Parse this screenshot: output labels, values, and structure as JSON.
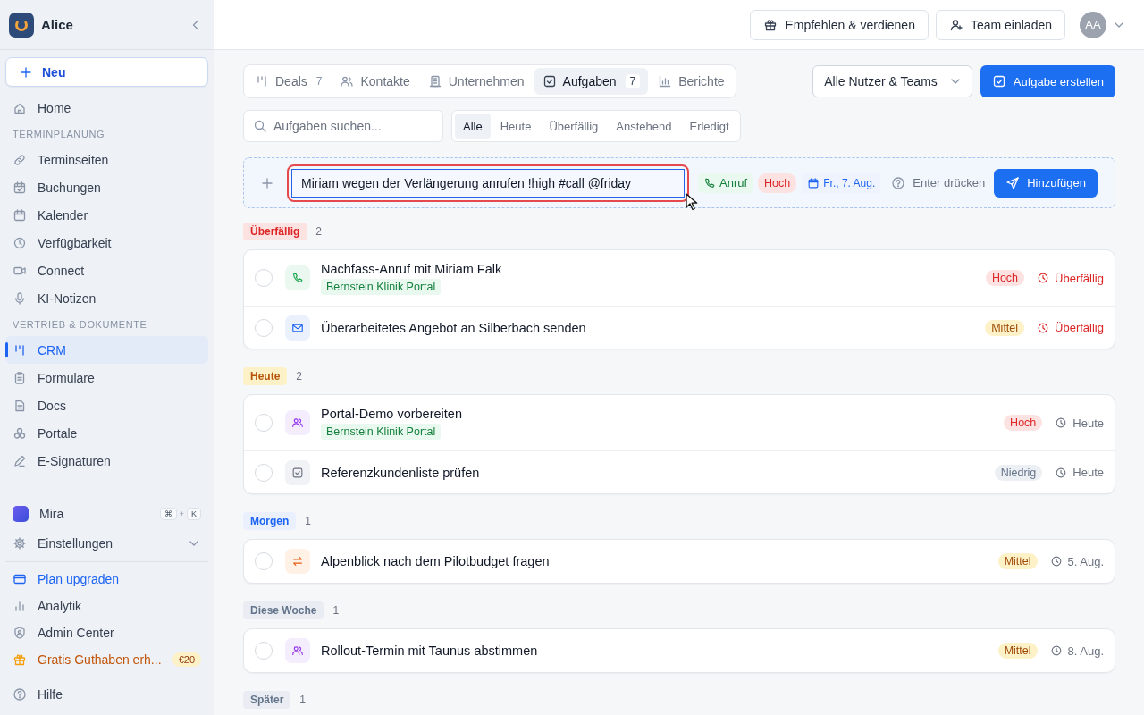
{
  "sidebar": {
    "workspace": "Alice",
    "new_button": "Neu",
    "items": [
      {
        "kind": "link",
        "label": "Home",
        "selected": false
      },
      {
        "kind": "heading",
        "label": "TERMINPLANUNG"
      },
      {
        "kind": "link",
        "label": "Terminseiten",
        "selected": false
      },
      {
        "kind": "link",
        "label": "Buchungen",
        "selected": false
      },
      {
        "kind": "link",
        "label": "Kalender",
        "selected": false
      },
      {
        "kind": "link",
        "label": "Verfügbarkeit",
        "selected": false
      },
      {
        "kind": "link",
        "label": "Connect",
        "selected": false
      },
      {
        "kind": "link",
        "label": "KI-Notizen",
        "selected": false
      },
      {
        "kind": "heading",
        "label": "VERTRIEB & DOKUMENTE"
      },
      {
        "kind": "link",
        "label": "CRM",
        "selected": true
      },
      {
        "kind": "link",
        "label": "Formulare",
        "selected": false
      },
      {
        "kind": "link",
        "label": "Docs",
        "selected": false
      },
      {
        "kind": "link",
        "label": "Portale",
        "selected": false
      },
      {
        "kind": "link",
        "label": "E-Signaturen",
        "selected": false
      }
    ],
    "assistant": {
      "label": "Mira",
      "keys": [
        "⌘",
        "+",
        "K"
      ]
    },
    "settings": {
      "label": "Einstellungen",
      "expanded": false
    },
    "bottom_items": [
      {
        "kind": "upgrade",
        "label": "Plan upgraden"
      },
      {
        "kind": "analytics",
        "label": "Analytik"
      },
      {
        "kind": "admin",
        "label": "Admin Center"
      },
      {
        "kind": "gift",
        "label": "Gratis Guthaben erh...",
        "badge": "€20"
      }
    ],
    "help": "Hilfe"
  },
  "header": {
    "buttons": [
      {
        "kind": "gift",
        "label": "Empfehlen & verdienen"
      },
      {
        "kind": "invite",
        "label": "Team einladen"
      }
    ],
    "avatar": "AA"
  },
  "tabs": [
    {
      "label": "Deals",
      "count": "7",
      "selected": false
    },
    {
      "label": "Kontakte",
      "selected": false
    },
    {
      "label": "Unternehmen",
      "selected": false
    },
    {
      "label": "Aufgaben",
      "count": "7",
      "selected": true
    },
    {
      "label": "Berichte",
      "selected": false
    }
  ],
  "owner_filter": "Alle Nutzer & Teams",
  "create_button": "Aufgabe erstellen",
  "search": {
    "placeholder": "Aufgaben suchen..."
  },
  "filters": [
    {
      "label": "Alle",
      "selected": true
    },
    {
      "label": "Heute",
      "selected": false
    },
    {
      "label": "Überfällig",
      "selected": false
    },
    {
      "label": "Anstehend",
      "selected": false
    },
    {
      "label": "Erledigt",
      "selected": false
    }
  ],
  "quick_add": {
    "value": "Miriam wegen der Verlängerung anrufen !high #call @friday",
    "highlighted": true,
    "chips": [
      {
        "kind": "type",
        "label": "Anruf"
      },
      {
        "kind": "priority",
        "label": "Hoch"
      },
      {
        "kind": "date",
        "label": "Fr., 7. Aug."
      }
    ],
    "hint": "Enter drücken",
    "button": "Hinzufügen"
  },
  "groups": [
    {
      "kind": "overdue",
      "label": "Überfällig",
      "count": "2",
      "tasks": [
        {
          "kind": "call",
          "title": "Nachfass-Anruf mit Miriam Falk",
          "tag": "Bernstein Klinik Portal",
          "checked": false,
          "priority": {
            "kind": "high",
            "label": "Hoch"
          },
          "due": {
            "label": "Überfällig",
            "overdue": true
          }
        },
        {
          "kind": "email",
          "title": "Überarbeitetes Angebot an Silberbach senden",
          "checked": false,
          "priority": {
            "kind": "medium",
            "label": "Mittel"
          },
          "due": {
            "label": "Überfällig",
            "overdue": true
          }
        }
      ]
    },
    {
      "kind": "today",
      "label": "Heute",
      "count": "2",
      "tasks": [
        {
          "kind": "meeting",
          "title": "Portal-Demo vorbereiten",
          "tag": "Bernstein Klinik Portal",
          "checked": false,
          "priority": {
            "kind": "high",
            "label": "Hoch"
          },
          "due": {
            "label": "Heute",
            "overdue": false
          }
        },
        {
          "kind": "todo",
          "title": "Referenzkundenliste prüfen",
          "checked": false,
          "priority": {
            "kind": "low",
            "label": "Niedrig"
          },
          "due": {
            "label": "Heute",
            "overdue": false
          }
        }
      ]
    },
    {
      "kind": "tomorrow",
      "label": "Morgen",
      "count": "1",
      "tasks": [
        {
          "kind": "followup",
          "title": "Alpenblick nach dem Pilotbudget fragen",
          "checked": false,
          "priority": {
            "kind": "medium",
            "label": "Mittel"
          },
          "due": {
            "label": "5. Aug.",
            "overdue": false
          }
        }
      ]
    },
    {
      "kind": "week",
      "label": "Diese Woche",
      "count": "1",
      "tasks": [
        {
          "kind": "meeting",
          "title": "Rollout-Termin mit Taunus abstimmen",
          "checked": false,
          "priority": {
            "kind": "medium",
            "label": "Mittel"
          },
          "due": {
            "label": "8. Aug.",
            "overdue": false
          }
        }
      ]
    },
    {
      "kind": "later",
      "label": "Später",
      "count": "1"
    }
  ]
}
